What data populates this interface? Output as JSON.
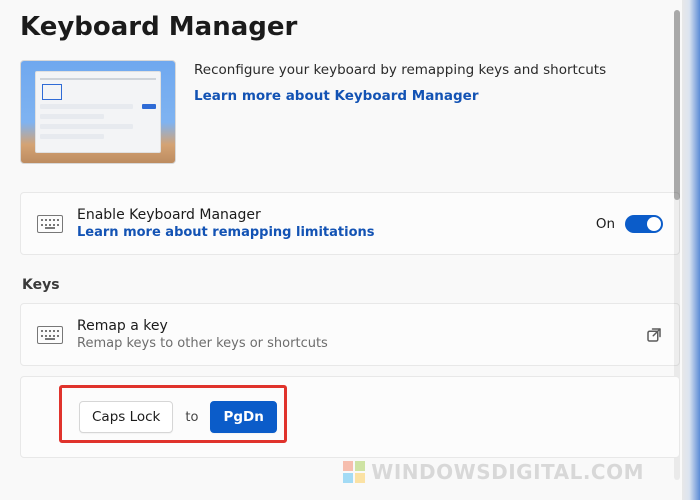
{
  "page": {
    "title": "Keyboard Manager"
  },
  "hero": {
    "description": "Reconfigure your keyboard by remapping keys and shortcuts",
    "link": "Learn more about Keyboard Manager"
  },
  "enable": {
    "title": "Enable Keyboard Manager",
    "link": "Learn more about remapping limitations",
    "state_label": "On",
    "on": true
  },
  "sections": {
    "keys_label": "Keys"
  },
  "remap": {
    "title": "Remap a key",
    "subtitle": "Remap keys to other keys or shortcuts"
  },
  "mapping": {
    "from": "Caps Lock",
    "separator": "to",
    "to": "PgDn"
  },
  "watermark": {
    "text": "WINDOWSDIGITAL.COM"
  }
}
